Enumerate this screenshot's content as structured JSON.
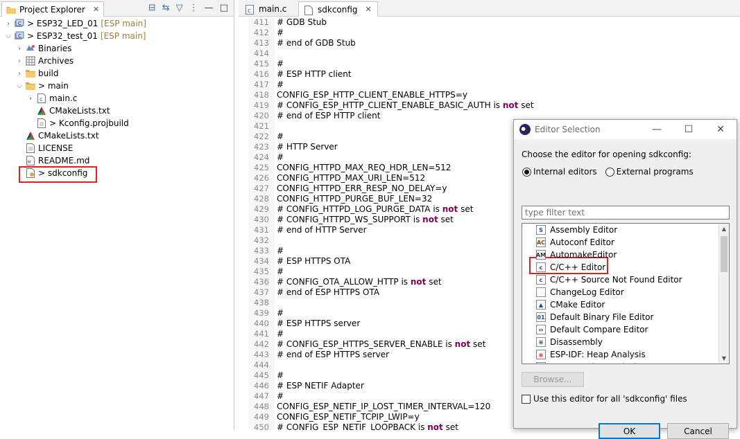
{
  "explorer": {
    "tab_label": "Project Explorer",
    "tree": [
      {
        "indent": 0,
        "twisty": ">",
        "icon": "project-icon",
        "label": "> ESP32_LED_01",
        "tag": "[ESP main]"
      },
      {
        "indent": 0,
        "twisty": "v",
        "icon": "project-icon",
        "label": "> ESP32_test_01",
        "tag": "[ESP main]"
      },
      {
        "indent": 1,
        "twisty": ">",
        "icon": "binaries-icon",
        "label": "Binaries",
        "tag": ""
      },
      {
        "indent": 1,
        "twisty": ">",
        "icon": "archives-icon",
        "label": "Archives",
        "tag": ""
      },
      {
        "indent": 1,
        "twisty": ">",
        "icon": "folder-icon",
        "label": "build",
        "tag": ""
      },
      {
        "indent": 1,
        "twisty": "v",
        "icon": "folder-icon",
        "label": "> main",
        "tag": ""
      },
      {
        "indent": 2,
        "twisty": ">",
        "icon": "c-file-icon",
        "label": "main.c",
        "tag": ""
      },
      {
        "indent": 2,
        "twisty": "",
        "icon": "cmake-icon",
        "label": "CMakeLists.txt",
        "tag": ""
      },
      {
        "indent": 2,
        "twisty": "",
        "icon": "file-icon",
        "label": "> Kconfig.projbuild",
        "tag": ""
      },
      {
        "indent": 1,
        "twisty": "",
        "icon": "cmake-icon",
        "label": "CMakeLists.txt",
        "tag": ""
      },
      {
        "indent": 1,
        "twisty": "",
        "icon": "file-icon",
        "label": "LICENSE",
        "tag": ""
      },
      {
        "indent": 1,
        "twisty": "",
        "icon": "markdown-icon",
        "label": "README.md",
        "tag": ""
      },
      {
        "indent": 1,
        "twisty": "",
        "icon": "config-file-icon",
        "label": "> sdkconfig",
        "tag": ""
      }
    ]
  },
  "editor": {
    "tabs": [
      {
        "label": "main.c",
        "icon": "c-file-icon"
      },
      {
        "label": "sdkconfig",
        "icon": "file-icon"
      }
    ],
    "lines": [
      {
        "n": "411",
        "t": "# GDB Stub"
      },
      {
        "n": "412",
        "t": "#"
      },
      {
        "n": "413",
        "t": "# end of GDB Stub"
      },
      {
        "n": "414",
        "t": ""
      },
      {
        "n": "415",
        "t": "#"
      },
      {
        "n": "416",
        "t": "# ESP HTTP client"
      },
      {
        "n": "417",
        "t": "#"
      },
      {
        "n": "418",
        "t": "CONFIG_ESP_HTTP_CLIENT_ENABLE_HTTPS=y"
      },
      {
        "n": "419",
        "t": "# CONFIG_ESP_HTTP_CLIENT_ENABLE_BASIC_AUTH is ",
        "k": "not",
        "e": " set"
      },
      {
        "n": "420",
        "t": "# end of ESP HTTP client"
      },
      {
        "n": "421",
        "t": ""
      },
      {
        "n": "422",
        "t": "#"
      },
      {
        "n": "423",
        "t": "# HTTP Server"
      },
      {
        "n": "424",
        "t": "#"
      },
      {
        "n": "425",
        "t": "CONFIG_HTTPD_MAX_REQ_HDR_LEN=512"
      },
      {
        "n": "426",
        "t": "CONFIG_HTTPD_MAX_URI_LEN=512"
      },
      {
        "n": "427",
        "t": "CONFIG_HTTPD_ERR_RESP_NO_DELAY=y"
      },
      {
        "n": "428",
        "t": "CONFIG_HTTPD_PURGE_BUF_LEN=32"
      },
      {
        "n": "429",
        "t": "# CONFIG_HTTPD_LOG_PURGE_DATA is ",
        "k": "not",
        "e": " set"
      },
      {
        "n": "430",
        "t": "# CONFIG_HTTPD_WS_SUPPORT is ",
        "k": "not",
        "e": " set"
      },
      {
        "n": "431",
        "t": "# end of HTTP Server"
      },
      {
        "n": "432",
        "t": ""
      },
      {
        "n": "433",
        "t": "#"
      },
      {
        "n": "434",
        "t": "# ESP HTTPS OTA"
      },
      {
        "n": "435",
        "t": "#"
      },
      {
        "n": "436",
        "t": "# CONFIG_OTA_ALLOW_HTTP is ",
        "k": "not",
        "e": " set"
      },
      {
        "n": "437",
        "t": "# end of ESP HTTPS OTA"
      },
      {
        "n": "438",
        "t": ""
      },
      {
        "n": "439",
        "t": "#"
      },
      {
        "n": "440",
        "t": "# ESP HTTPS server"
      },
      {
        "n": "441",
        "t": "#"
      },
      {
        "n": "442",
        "t": "# CONFIG_ESP_HTTPS_SERVER_ENABLE is ",
        "k": "not",
        "e": " set"
      },
      {
        "n": "443",
        "t": "# end of ESP HTTPS server"
      },
      {
        "n": "444",
        "t": ""
      },
      {
        "n": "445",
        "t": "#"
      },
      {
        "n": "446",
        "t": "# ESP NETIF Adapter"
      },
      {
        "n": "447",
        "t": "#"
      },
      {
        "n": "448",
        "t": "CONFIG_ESP_NETIF_IP_LOST_TIMER_INTERVAL=120"
      },
      {
        "n": "449",
        "t": "CONFIG_ESP_NETIF_TCPIP_LWIP=y"
      },
      {
        "n": "450",
        "t": "# CONFIG_ESP_NETIF_LOOPBACK is ",
        "k": "not",
        "e": " set"
      }
    ]
  },
  "dialog": {
    "title": "Editor Selection",
    "prompt": "Choose the editor for opening sdkconfig:",
    "radio_internal": "Internal editors",
    "radio_external": "External programs",
    "filter_placeholder": "type filter text",
    "items": [
      {
        "label": "Assembly Editor",
        "glyph": "S"
      },
      {
        "label": "Autoconf Editor",
        "glyph": "AC"
      },
      {
        "label": "AutomakeEditor",
        "glyph": "AM"
      },
      {
        "label": "C/C++ Editor",
        "glyph": "c"
      },
      {
        "label": "C/C++ Source Not Found Editor",
        "glyph": "c"
      },
      {
        "label": "ChangeLog Editor",
        "glyph": ""
      },
      {
        "label": "CMake Editor",
        "glyph": "▲"
      },
      {
        "label": "Default Binary File Editor",
        "glyph": "01"
      },
      {
        "label": "Default Compare Editor",
        "glyph": "⇔"
      },
      {
        "label": "Disassembly",
        "glyph": "≡"
      },
      {
        "label": "ESP-IDF: Heap Analysis",
        "glyph": "◉"
      },
      {
        "label": "ESP-IDF: Size Analysis",
        "glyph": "▤"
      }
    ],
    "browse_label": "Browse...",
    "checkbox_label": "Use this editor for all 'sdkconfig' files",
    "ok_label": "OK",
    "cancel_label": "Cancel"
  }
}
